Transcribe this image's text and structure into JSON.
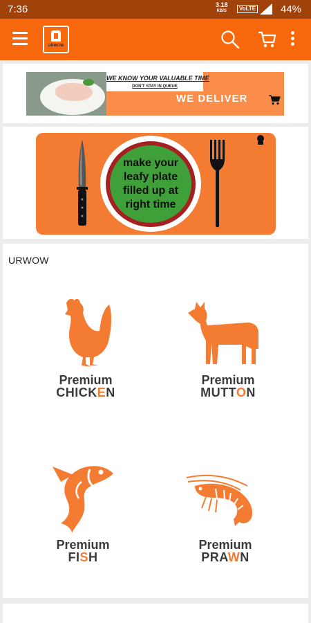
{
  "status_bar": {
    "time": "7:36",
    "speed_value": "3.18",
    "speed_unit": "KB/S",
    "network": "VoLTE",
    "battery": "44%"
  },
  "app_bar": {
    "logo_text": "URWOW",
    "icons": [
      "menu-icon",
      "search-icon",
      "cart-icon",
      "more-icon"
    ],
    "color": "#f8690e"
  },
  "banners": {
    "delivery": {
      "headline": "WE KNOW YOUR VALUABLE TIME",
      "subline": "DON'T STAY IN QUEUE",
      "cta": "WE DELIVER"
    },
    "plate": {
      "line1": "make your",
      "line2": "leafy plate",
      "line3": "filled up at",
      "line4": "right time"
    }
  },
  "section": {
    "title": "URWOW"
  },
  "categories": [
    {
      "title": "Premium",
      "name_start": "CHICK",
      "name_highlight": "E",
      "name_end": "N",
      "icon": "chicken-icon"
    },
    {
      "title": "Premium",
      "name_start": "MUTT",
      "name_highlight": "O",
      "name_end": "N",
      "icon": "goat-icon"
    },
    {
      "title": "Premium",
      "name_start": "FI",
      "name_highlight": "S",
      "name_end": "H",
      "icon": "fish-icon"
    },
    {
      "title": "Premium",
      "name_start": "PRA",
      "name_highlight": "W",
      "name_end": "N",
      "icon": "prawn-icon"
    }
  ],
  "colors": {
    "accent": "#f47b32",
    "status_bar": "#a0420a",
    "text_dark": "#3a3a3a"
  }
}
